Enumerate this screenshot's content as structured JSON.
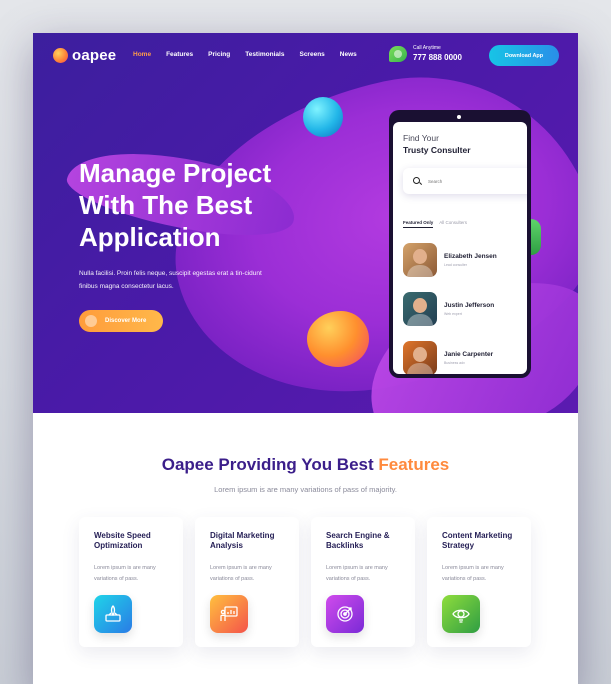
{
  "brand": {
    "name": "oapee"
  },
  "nav": {
    "items": [
      {
        "label": "Home",
        "active": true
      },
      {
        "label": "Features",
        "active": false
      },
      {
        "label": "Pricing",
        "active": false
      },
      {
        "label": "Testimonials",
        "active": false
      },
      {
        "label": "Screens",
        "active": false
      },
      {
        "label": "News",
        "active": false
      }
    ],
    "call_label": "Call Anytime",
    "call_number": "777 888 0000",
    "download_label": "Download App"
  },
  "hero": {
    "title_lines": [
      "Manage Project",
      "With The Best",
      "Application"
    ],
    "description": "Nulla facilisi. Proin felis neque, suscipit egestas erat a tin-cidunt finibus magna consectetur lacus.",
    "cta_label": "Discover More"
  },
  "phone": {
    "heading_line_1": "Find Your",
    "heading_line_2": "Trusty Consulter",
    "search_placeholder": "Search",
    "tabs": [
      "Featured Only",
      "All Consulters"
    ],
    "consultants": [
      {
        "name": "Elizabeth Jensen",
        "role": "Lead consulter"
      },
      {
        "name": "Justin Jefferson",
        "role": "Web expert"
      },
      {
        "name": "Janie Carpenter",
        "role": "Business adv"
      }
    ]
  },
  "features": {
    "title_main": "Oapee Providing You Best ",
    "title_accent": "Features",
    "subtitle": "Lorem ipsum is are many variations of pass of majority.",
    "cards": [
      {
        "title": "Website Speed Optimization",
        "text": "Lorem ipsum is are many variations of pass.",
        "icon": "rocket-icon"
      },
      {
        "title": "Digital Marketing Analysis",
        "text": "Lorem ipsum is are many variations of pass.",
        "icon": "presentation-chart-icon"
      },
      {
        "title": "Search Engine & Backlinks",
        "text": "Lorem ipsum is are many variations of pass.",
        "icon": "target-icon"
      },
      {
        "title": "Content Marketing Strategy",
        "text": "Lorem ipsum is are many variations of pass.",
        "icon": "eye-bulb-icon"
      }
    ]
  },
  "colors": {
    "hero_bg": "#4a1aa8",
    "accent_orange": "#ff8a3d",
    "title_purple": "#3b1e8a",
    "button_blue": "#17c4e6"
  }
}
